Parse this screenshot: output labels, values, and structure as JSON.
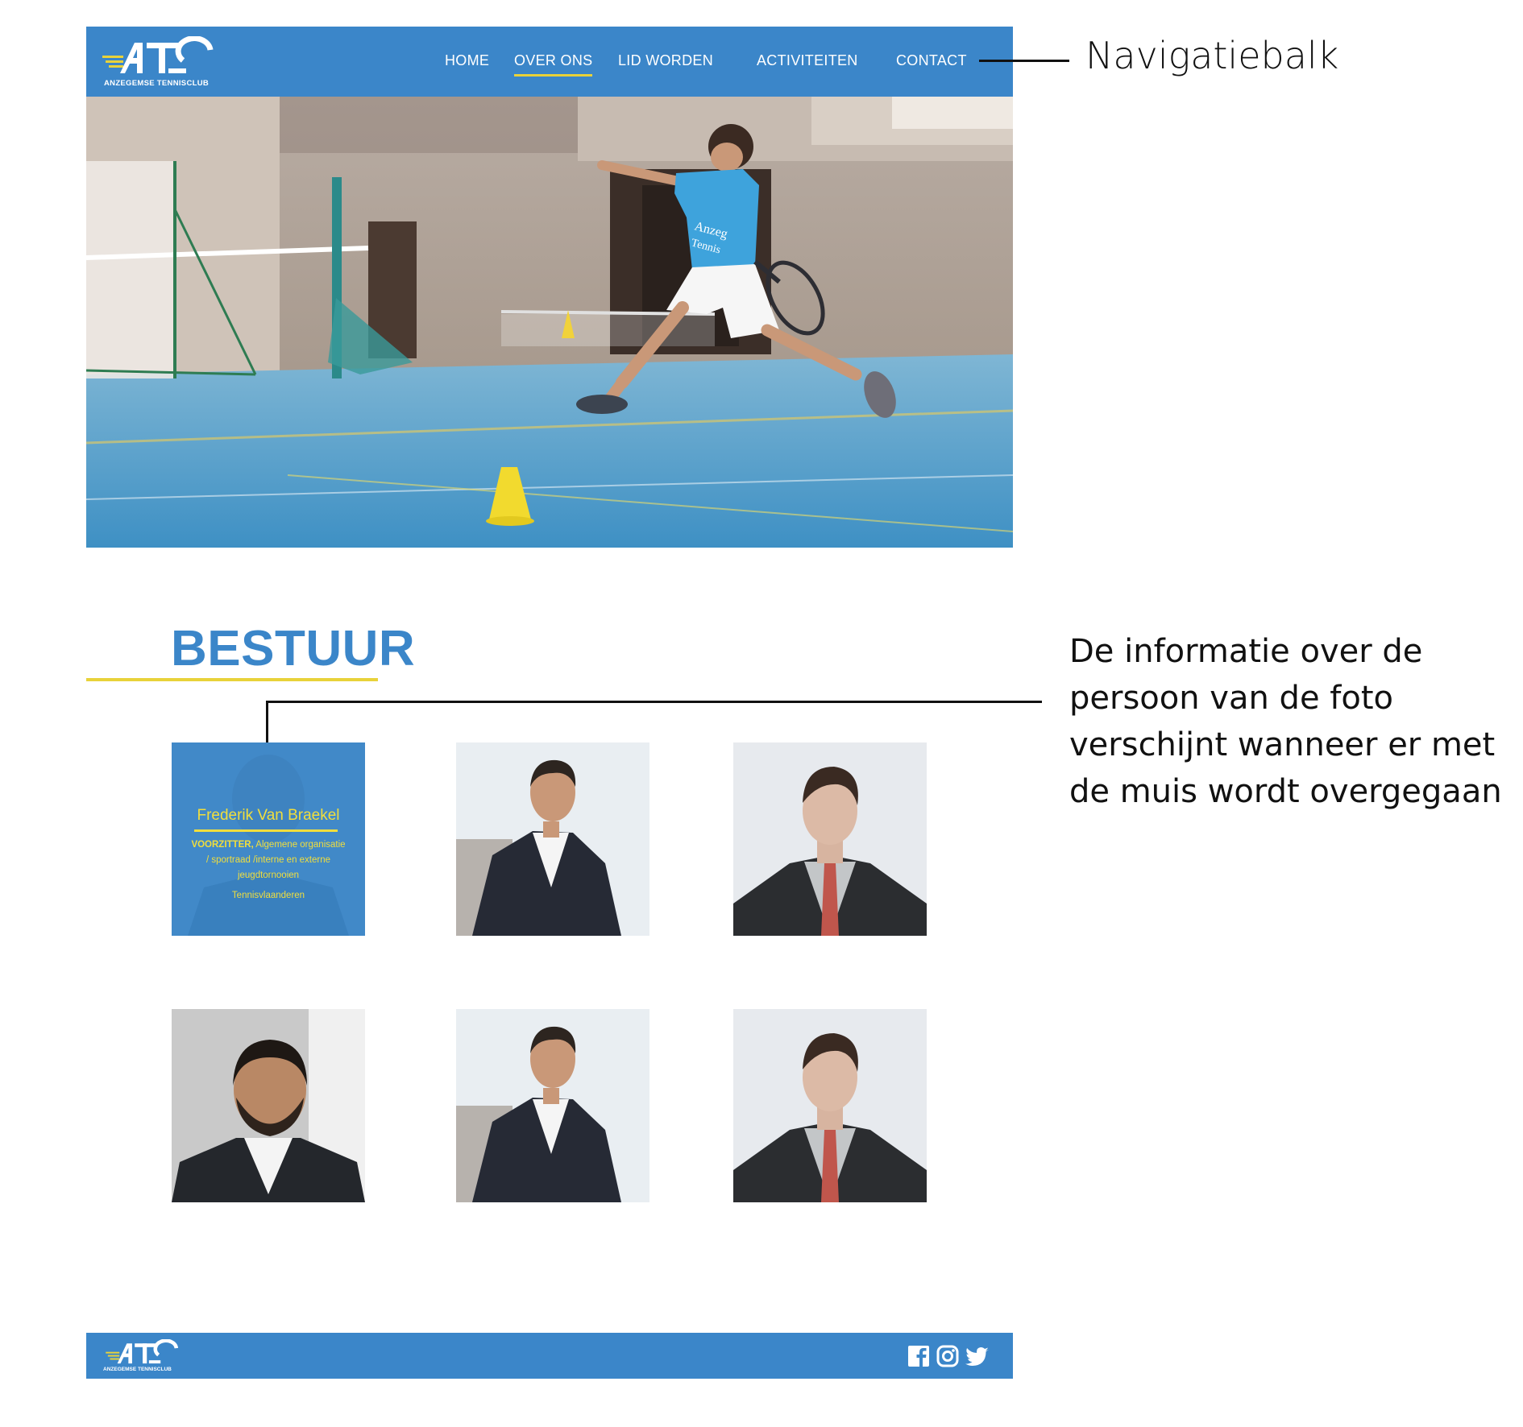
{
  "nav": {
    "logo_text": "ANZEGEMSE TENNISCLUB",
    "links": [
      {
        "label": "HOME",
        "active": false
      },
      {
        "label": "OVER ONS",
        "active": true
      },
      {
        "label": "LID WORDEN",
        "active": false
      },
      {
        "label": "ACTIVITEITEN",
        "active": false
      },
      {
        "label": "CONTACT",
        "active": false
      }
    ]
  },
  "hero": {
    "shirt_text_1": "Anzeg",
    "shirt_text_2": "Tennis"
  },
  "annotations": {
    "navbar": "Navigatiebalk",
    "hover_info": "De informatie over de persoon van de foto verschijnt wanneer er met de muis wordt overgegaan"
  },
  "bestuur": {
    "title": "BESTUUR",
    "hover_card": {
      "name": "Frederik Van Braekel",
      "role_bold": "VOORZITTER,",
      "role_rest": " Algemene organisatie / sportraad /interne en externe jeugdtornooien",
      "org": "Tennisvlaanderen"
    }
  },
  "footer": {
    "logo_text": "ANZEGEMSE TENNISCLUB",
    "social": [
      "facebook-icon",
      "instagram-icon",
      "twitter-icon"
    ]
  },
  "colors": {
    "brand_blue": "#3b86c9",
    "accent_yellow": "#e8d23a"
  }
}
